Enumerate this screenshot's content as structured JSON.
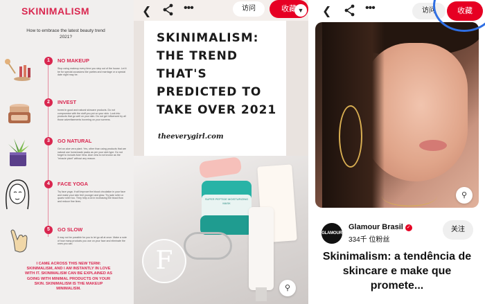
{
  "infographic": {
    "title": "SKINIMALISM",
    "subtitle": "How to embrace the latest beauty trend 2021?",
    "steps": [
      {
        "num": "1",
        "label": "NO MAKEUP",
        "desc": "Stop using makeup every time you step out of the house. Let it be for special occasions like parties and marriage or a special date night may be."
      },
      {
        "num": "2",
        "label": "INVEST",
        "desc": "Invest in good and natural skincare products. Do not compromise with the stuff you put on your skin. Look into products that go well on your skin. Do not get influenced by all those advertisements hovering on your screens."
      },
      {
        "num": "3",
        "label": "GO NATURAL",
        "desc": "Get an aloe vera plant. Yes, other than using products that are natural use homemade packs as per your skin type. Do not forget to include Aloe Vera. Aloe vera is not known as the \"miracle plant\" without any reason."
      },
      {
        "num": "4",
        "label": "FACE YOGA",
        "desc": "Try face yoga. It will improve the blood circulation in your face and make your skin feel younger and glow. Try jade roller or quartz roller too. They help a lot in increasing the blood flow and reduce fine lines."
      },
      {
        "num": "5",
        "label": "GO SLOW",
        "desc": "It may not be possible for you to let go all at once. Make a note of how many products you use on your face and eliminate the ones you can."
      }
    ],
    "footer": "I CAME ACROSS THIS NEW TERM: SKINIMALISM, AND I AM INSTANTLY IN LOVE WITH IT. SKINIMALISM CAN BE EXPLAINED AS GOING WITH MINIMAL PRODUCTS ON YOUR SKIN. SKINIMALISM IS THE MAKEUP MINIMALISM."
  },
  "pin_middle": {
    "visit_label": "访问",
    "save_label": "收藏",
    "headline": "SKINIMALISM: THE TREND THAT'S PREDICTED TO TAKE OVER 2021",
    "handle": "theeverygirl.com",
    "logo_letter": "F",
    "jar_text": "SUPER PEPTIDE MOISTURIZING MASK"
  },
  "pin_right": {
    "visit_label": "访问",
    "save_label": "收藏",
    "account_logo": "GLAMOUR",
    "account_name": "Glamour Brasil",
    "followers": "334千 位粉丝",
    "follow_label": "关注",
    "title": "Skinimalism: a tendência de skincare e make que promete..."
  },
  "colors": {
    "brand_red": "#e60023",
    "infographic_pink": "#d9264f",
    "highlight_ring": "#2f6fe3"
  },
  "icons": [
    "back-arrow-icon",
    "share-icon",
    "more-icon",
    "chevron-down-icon",
    "visual-search-icon",
    "verified-icon"
  ]
}
